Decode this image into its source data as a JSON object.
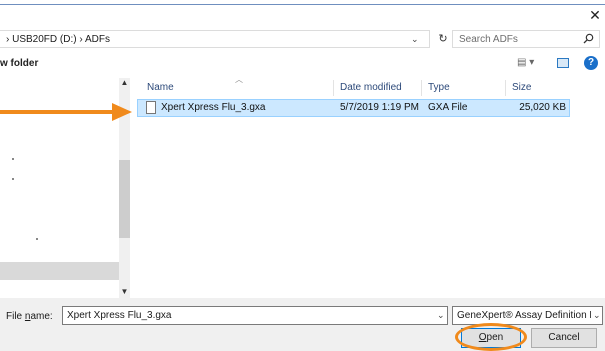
{
  "window": {
    "close_glyph": "✕"
  },
  "addressbar": {
    "path_prefix": "›",
    "drive": "USB20FD (D:)",
    "separator": "›",
    "folder": "ADFs",
    "dropdown_glyph": "⌄",
    "refresh_glyph": "↻"
  },
  "search": {
    "placeholder": "Search ADFs",
    "icon": "search-icon"
  },
  "toolbar": {
    "new_folder_label": "w folder",
    "view_glyph": "▤ ▾",
    "help_glyph": "?"
  },
  "columns": {
    "name": "Name",
    "date": "Date modified",
    "type": "Type",
    "size": "Size"
  },
  "files": [
    {
      "name": "Xpert Xpress Flu_3.gxa",
      "date": "5/7/2019 1:19 PM",
      "type": "GXA File",
      "size": "25,020 KB"
    }
  ],
  "bottom": {
    "filename_label_pre": "File ",
    "filename_label_u": "n",
    "filename_label_post": "ame:",
    "filename_value": "Xpert Xpress Flu_3.gxa",
    "filetype_value": "GeneXpert® Assay Definition F",
    "open_u": "O",
    "open_rest": "pen",
    "cancel_label": "Cancel"
  },
  "colors": {
    "arrow": "#f08a1c",
    "ring": "#f08a1c",
    "selection": "#cce8ff",
    "accent": "#0078d7"
  }
}
